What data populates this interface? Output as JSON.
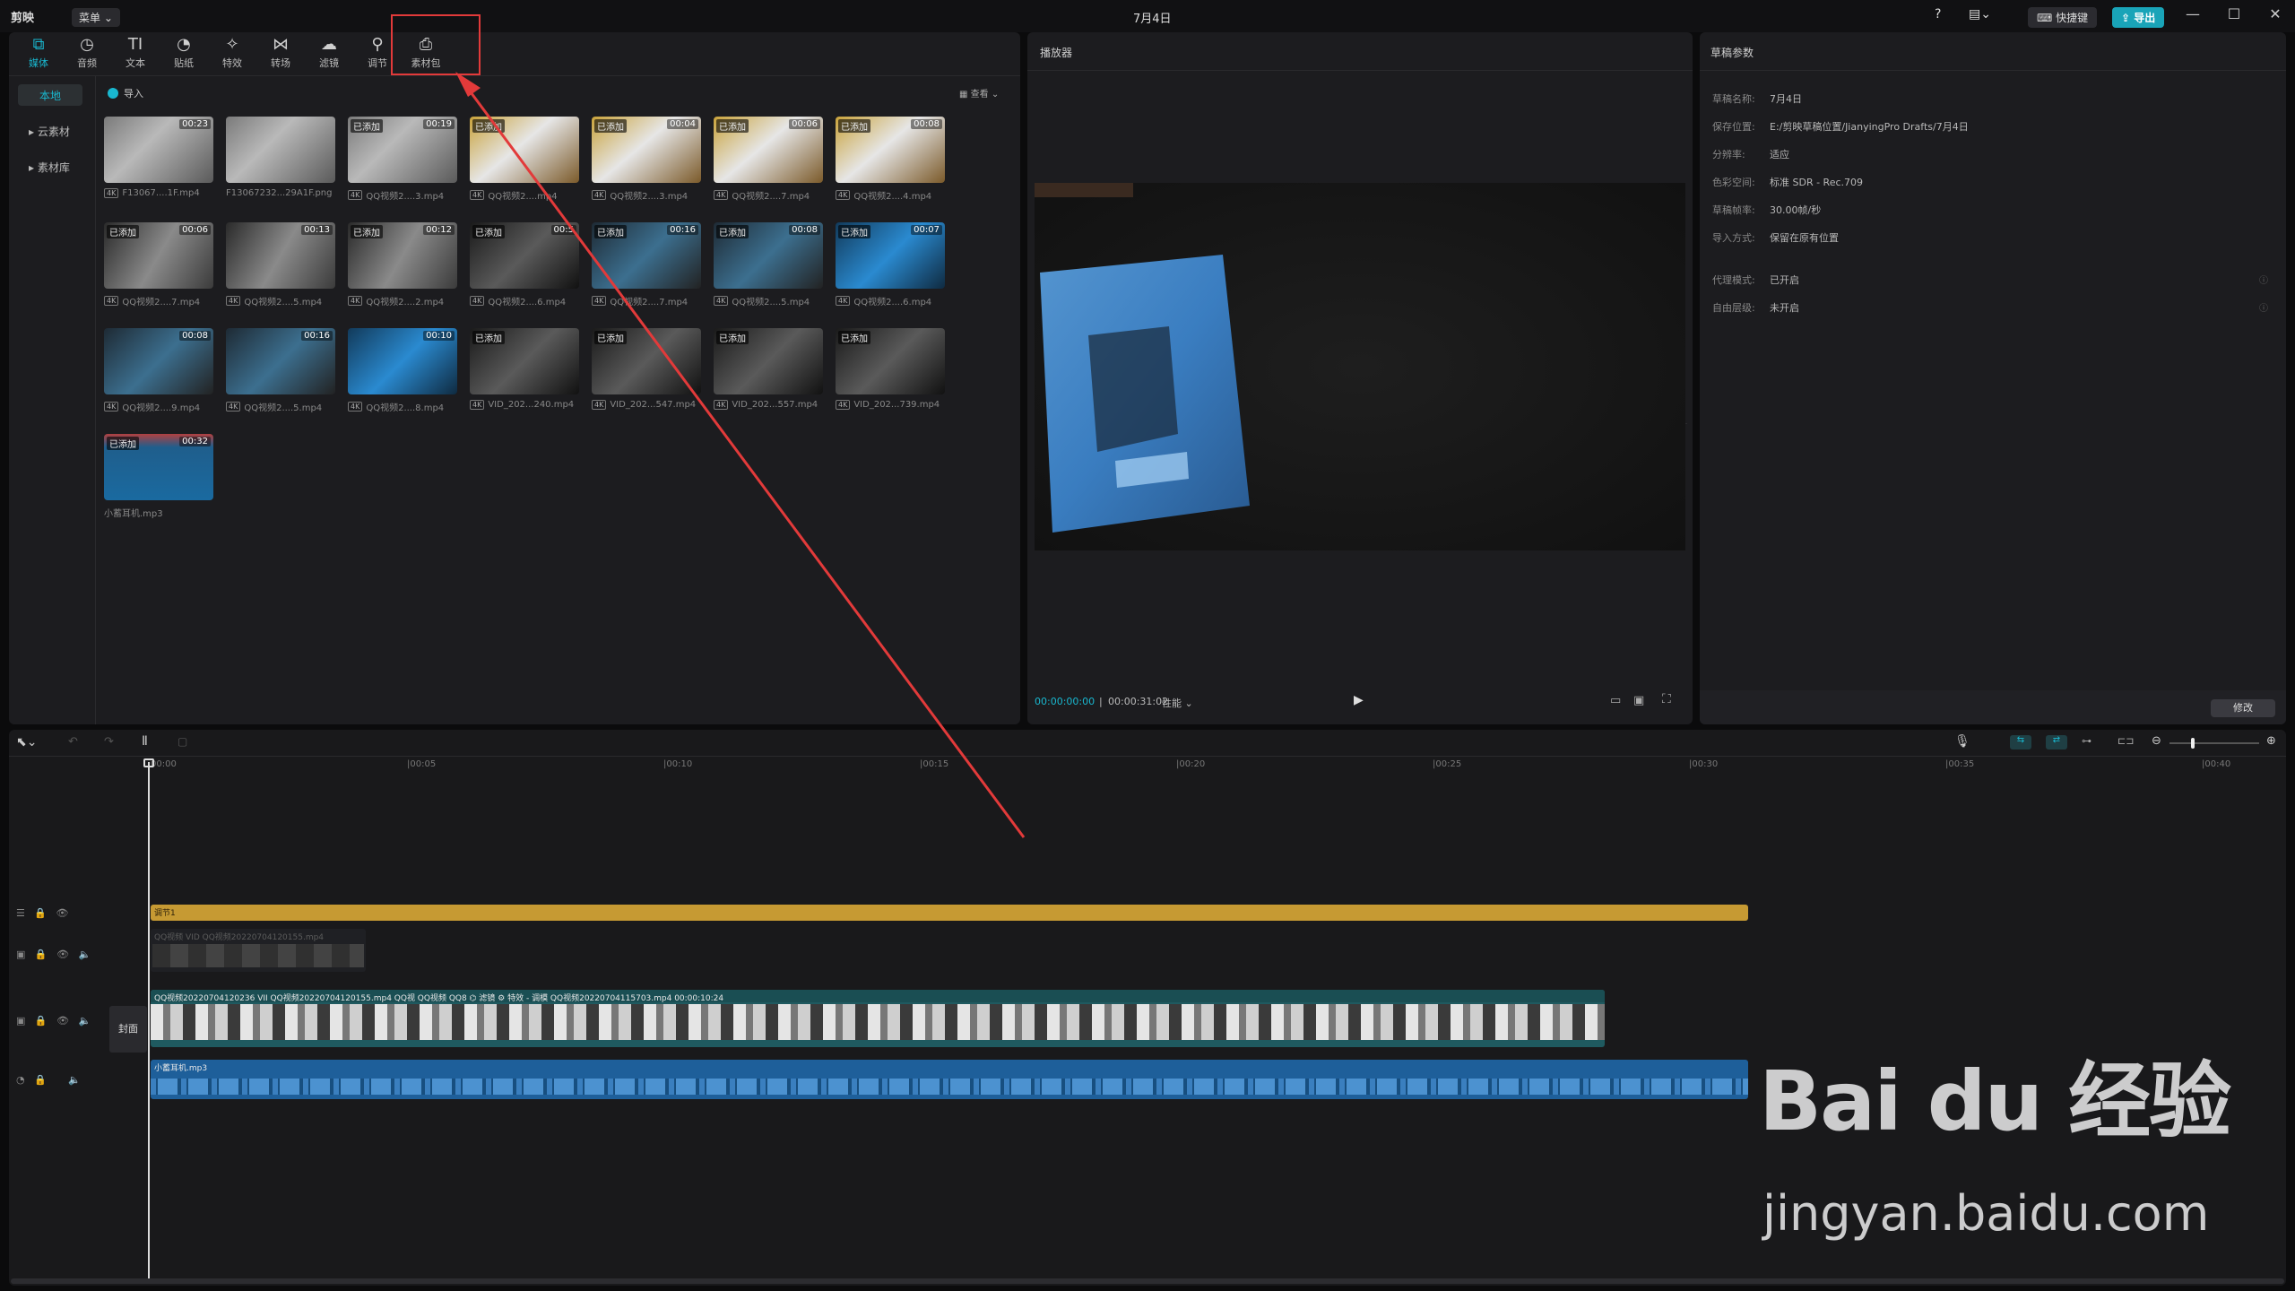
{
  "titlebar": {
    "app_name": "剪映",
    "menu_label": "菜单",
    "project_title": "7月4日",
    "shortcut_label": "快捷键",
    "export_label": "导出",
    "help_icon": "help-icon",
    "layout_icon": "layout-icon"
  },
  "media_tabs": [
    {
      "label": "媒体",
      "icon": "media-icon",
      "active": true
    },
    {
      "label": "音频",
      "icon": "audio-icon",
      "active": false
    },
    {
      "label": "文本",
      "icon": "text-icon",
      "active": false
    },
    {
      "label": "贴纸",
      "icon": "sticker-icon",
      "active": false
    },
    {
      "label": "特效",
      "icon": "effects-icon",
      "active": false
    },
    {
      "label": "转场",
      "icon": "transition-icon",
      "active": false
    },
    {
      "label": "滤镜",
      "icon": "filter-icon",
      "active": false
    },
    {
      "label": "调节",
      "icon": "adjust-icon",
      "active": false
    },
    {
      "label": "素材包",
      "icon": "material-pack-icon",
      "active": false
    }
  ],
  "media_sidebar": [
    {
      "label": "本地",
      "active": true
    },
    {
      "label": "▸ 云素材",
      "active": false
    },
    {
      "label": "▸ 素材库",
      "active": false
    }
  ],
  "media": {
    "import_label": "导入",
    "sort_label": "查看",
    "items": [
      {
        "name": "F13067....1F.mp4",
        "duration": "00:23",
        "added": "",
        "style": "s0",
        "tag": "4K"
      },
      {
        "name": "F13067232...29A1F.png",
        "duration": "",
        "added": "",
        "style": "s0",
        "tag": ""
      },
      {
        "name": "QQ视频2....3.mp4",
        "duration": "00:19",
        "added": "已添加",
        "style": "s0",
        "tag": "4K"
      },
      {
        "name": "QQ视频2....mp4",
        "duration": "",
        "added": "已添加",
        "style": "s2",
        "tag": "4K"
      },
      {
        "name": "QQ视频2....3.mp4",
        "duration": "00:04",
        "added": "已添加",
        "style": "s2",
        "tag": "4K"
      },
      {
        "name": "QQ视频2....7.mp4",
        "duration": "00:06",
        "added": "已添加",
        "style": "s2",
        "tag": "4K"
      },
      {
        "name": "QQ视频2....4.mp4",
        "duration": "00:08",
        "added": "已添加",
        "style": "s2",
        "tag": "4K"
      },
      {
        "name": "QQ视频2....7.mp4",
        "duration": "00:06",
        "added": "已添加",
        "style": "s1",
        "tag": "4K"
      },
      {
        "name": "QQ视频2....5.mp4",
        "duration": "00:13",
        "added": "",
        "style": "s1",
        "tag": "4K"
      },
      {
        "name": "QQ视频2....2.mp4",
        "duration": "00:12",
        "added": "已添加",
        "style": "s1",
        "tag": "4K"
      },
      {
        "name": "QQ视频2....6.mp4",
        "duration": "00:5",
        "added": "已添加",
        "style": "s5",
        "tag": "4K"
      },
      {
        "name": "QQ视频2....7.mp4",
        "duration": "00:16",
        "added": "已添加",
        "style": "s3",
        "tag": "4K"
      },
      {
        "name": "QQ视频2....5.mp4",
        "duration": "00:08",
        "added": "已添加",
        "style": "s3",
        "tag": "4K"
      },
      {
        "name": "QQ视频2....6.mp4",
        "duration": "00:07",
        "added": "已添加",
        "style": "s4",
        "tag": "4K"
      },
      {
        "name": "QQ视频2....9.mp4",
        "duration": "00:08",
        "added": "",
        "style": "s3",
        "tag": "4K"
      },
      {
        "name": "QQ视频2....5.mp4",
        "duration": "00:16",
        "added": "",
        "style": "s3",
        "tag": "4K"
      },
      {
        "name": "QQ视频2....8.mp4",
        "duration": "00:10",
        "added": "",
        "style": "s4",
        "tag": "4K"
      },
      {
        "name": "VID_202...240.mp4",
        "duration": "",
        "added": "已添加",
        "style": "s5",
        "tag": "4K"
      },
      {
        "name": "VID_202...547.mp4",
        "duration": "",
        "added": "已添加",
        "style": "s5",
        "tag": "4K"
      },
      {
        "name": "VID_202...557.mp4",
        "duration": "",
        "added": "已添加",
        "style": "s5",
        "tag": "4K"
      },
      {
        "name": "VID_202...739.mp4",
        "duration": "",
        "added": "已添加",
        "style": "s5",
        "tag": "4K"
      },
      {
        "name": "小蓄耳机.mp3",
        "duration": "00:32",
        "added": "已添加",
        "style": "s6",
        "tag": ""
      }
    ]
  },
  "player": {
    "title": "播放器",
    "current_time": "00:00:00:00",
    "total_time": "00:00:31:02",
    "quality_label": "性能"
  },
  "draft": {
    "title": "草稿参数",
    "rows": [
      {
        "label": "草稿名称:",
        "value": "7月4日"
      },
      {
        "label": "保存位置:",
        "value": "E:/剪映草稿位置/JianyingPro Drafts/7月4日"
      },
      {
        "label": "分辨率:",
        "value": "适应"
      },
      {
        "label": "色彩空间:",
        "value": "标准 SDR - Rec.709"
      },
      {
        "label": "草稿帧率:",
        "value": "30.00帧/秒"
      },
      {
        "label": "导入方式:",
        "value": "保留在原有位置"
      }
    ],
    "rows2": [
      {
        "label": "代理模式:",
        "value": "已开启"
      },
      {
        "label": "自由层级:",
        "value": "未开启"
      }
    ],
    "modify_label": "修改"
  },
  "timeline": {
    "ruler": [
      "00:00",
      "|00:05",
      "|00:10",
      "|00:15",
      "|00:20",
      "|00:25",
      "|00:30",
      "|00:35",
      "|00:40"
    ],
    "adjust_clip_label": "调节1",
    "overlay_clip_label": "QQ视频  VID  QQ视频20220704120155.mp4",
    "main_clip_label": "QQ视频20220704120236  VII  QQ视频20220704120155.mp4   QQ视  QQ视频  QQ8  ⌬ 滤镜    ⚙ 特效 - 调模     QQ视频20220704115703.mp4    00:00:10:24",
    "cover_label": "封面",
    "audio_clip_label": "小蓄耳机.mp3"
  },
  "watermark": {
    "logo": "Bai du 经验",
    "url": "jingyan.baidu.com"
  },
  "colors": {
    "accent": "#19b8d0",
    "highlight_box": "#e23a3a",
    "arrow": "#e23a3a",
    "adjust_track": "#c69a33",
    "main_track": "#1f5a60",
    "audio_track": "#1e5f9a"
  }
}
